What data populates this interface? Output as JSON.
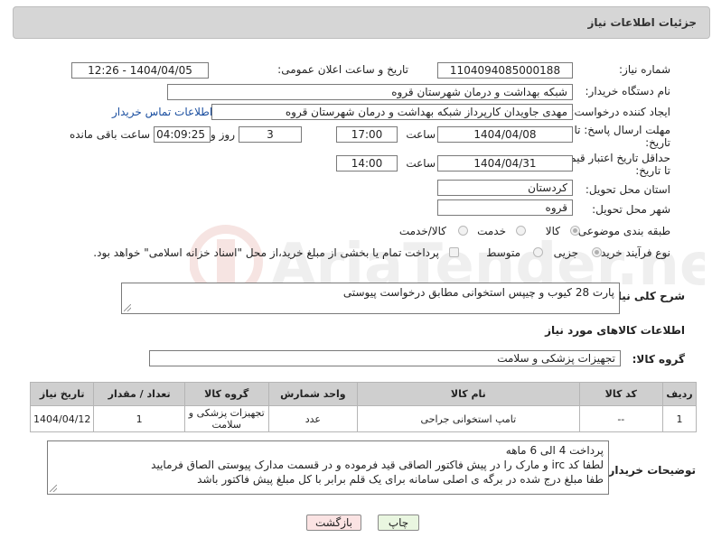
{
  "header": {
    "title": "جزئیات اطلاعات نیاز"
  },
  "fields": {
    "need_number": {
      "label": "شماره نیاز:",
      "value": "1104094085000188"
    },
    "announce": {
      "label": "تاریخ و ساعت اعلان عمومی:",
      "value": "1404/04/05 - 12:26"
    },
    "buyer_org": {
      "label": "نام دستگاه خریدار:",
      "value": "شبکه بهداشت و درمان شهرستان قروه"
    },
    "requester": {
      "label": "ایجاد کننده درخواست:",
      "value": "مهدی جاویدان کارپرداز شبکه بهداشت و درمان شهرستان قروه",
      "contact_link": "اطلاعات تماس خریدار"
    },
    "deadline": {
      "label_line1": "مهلت ارسال پاسخ: تا",
      "label_line2": "تاریخ:",
      "date": "1404/04/08",
      "time_label": "ساعت",
      "time": "17:00",
      "days": "3",
      "days_label": "روز و",
      "remaining": "04:09:25",
      "remaining_label": "ساعت باقی مانده"
    },
    "price_validity": {
      "label_line1": "حداقل تاریخ اعتبار قیمت:",
      "label_line2": "تا تاریخ:",
      "date": "1404/04/31",
      "time_label": "ساعت",
      "time": "14:00"
    },
    "province": {
      "label": "استان محل تحویل:",
      "value": "کردستان"
    },
    "city": {
      "label": "شهر محل تحویل:",
      "value": "قروه"
    },
    "category": {
      "label": "طبقه بندی موضوعی:",
      "options": [
        "کالا",
        "خدمت",
        "کالا/خدمت"
      ],
      "selected": "کالا"
    },
    "process": {
      "label": "نوع فرآیند خرید :",
      "options": [
        "جزیی",
        "متوسط"
      ],
      "selected": "جزیی",
      "payment_note": "پرداخت تمام یا بخشی از مبلغ خرید،از محل \"اسناد خزانه اسلامی\" خواهد بود."
    }
  },
  "general_desc": {
    "label": "شرح کلی نیاز:",
    "value": "پارت 28 کیوب و چیپس استخوانی مطابق درخواست پیوستی"
  },
  "goods_section": {
    "title": "اطلاعات کالاهای مورد نیاز"
  },
  "goods_group": {
    "label": "گروه کالا:",
    "value": "تجهیزات پزشکی و سلامت"
  },
  "table": {
    "headers": [
      "ردیف",
      "کد کالا",
      "نام کالا",
      "واحد شمارش",
      "گروه کالا",
      "تعداد / مقدار",
      "تاریخ نیاز"
    ],
    "rows": [
      [
        "1",
        "--",
        "تامپ استخوانی جراحی",
        "عدد",
        "تجهیزات پزشکی و سلامت",
        "1",
        "1404/04/12"
      ]
    ]
  },
  "buyer_notes": {
    "label": "توضیحات خریدار:",
    "lines": [
      "پرداخت 4 الی 6 ماهه",
      "لطفا کد irc  و مارک را در پیش فاکتور الصاقی قید فرموده و در قسمت مدارک پیوستی الصاق فرمایید",
      "طفا مبلغ درج شده در برگه ی اصلی سامانه برای یک قلم برابر با کل مبلغ پیش فاکتور باشد"
    ]
  },
  "buttons": {
    "print": "چاپ",
    "back": "بازگشت"
  },
  "colors": {
    "header_bg": "#d6d6d6",
    "table_header_bg": "#cfcfcf",
    "link": "#1b4fa0",
    "print_btn": "#e9f6e0",
    "back_btn": "#fbe3e3"
  }
}
